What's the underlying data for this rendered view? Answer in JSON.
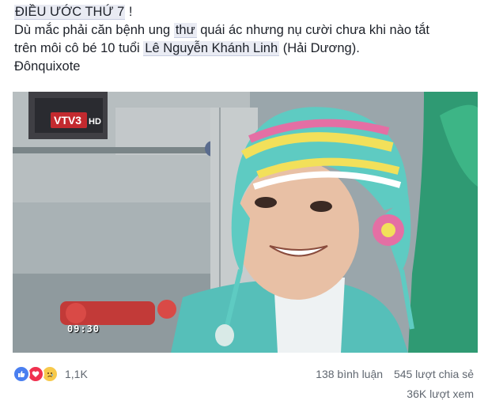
{
  "post": {
    "title_highlight": "ĐIỀU ƯỚC THỨ 7",
    "title_suffix": " !",
    "line2_pre": "Dù mắc phải căn bệnh ung ",
    "line2_hl": "thư",
    "line2_post": " quái ác nhưng nụ cười chưa khi nào tắt",
    "line3_pre": "trên môi cô bé 10 tuổi ",
    "line3_hl": "Lê Nguyễn Khánh Linh",
    "line3_post": " (Hải Dương).",
    "author": "Đônquixote"
  },
  "video": {
    "channel_logo": "VTV3 HD",
    "timestamp": "09:30"
  },
  "reactions": {
    "icons": [
      "like-icon",
      "love-icon",
      "sad-icon"
    ],
    "count": "1,1K"
  },
  "stats": {
    "comments": "138 bình luận",
    "shares": "545 lượt chia sẻ",
    "views": "36K lượt xem"
  },
  "colors": {
    "highlight_bg": "#e9ebf3",
    "like": "#4a7ff0",
    "love": "#f0314f",
    "sad": "#f7c94b",
    "meta_text": "#606770"
  }
}
